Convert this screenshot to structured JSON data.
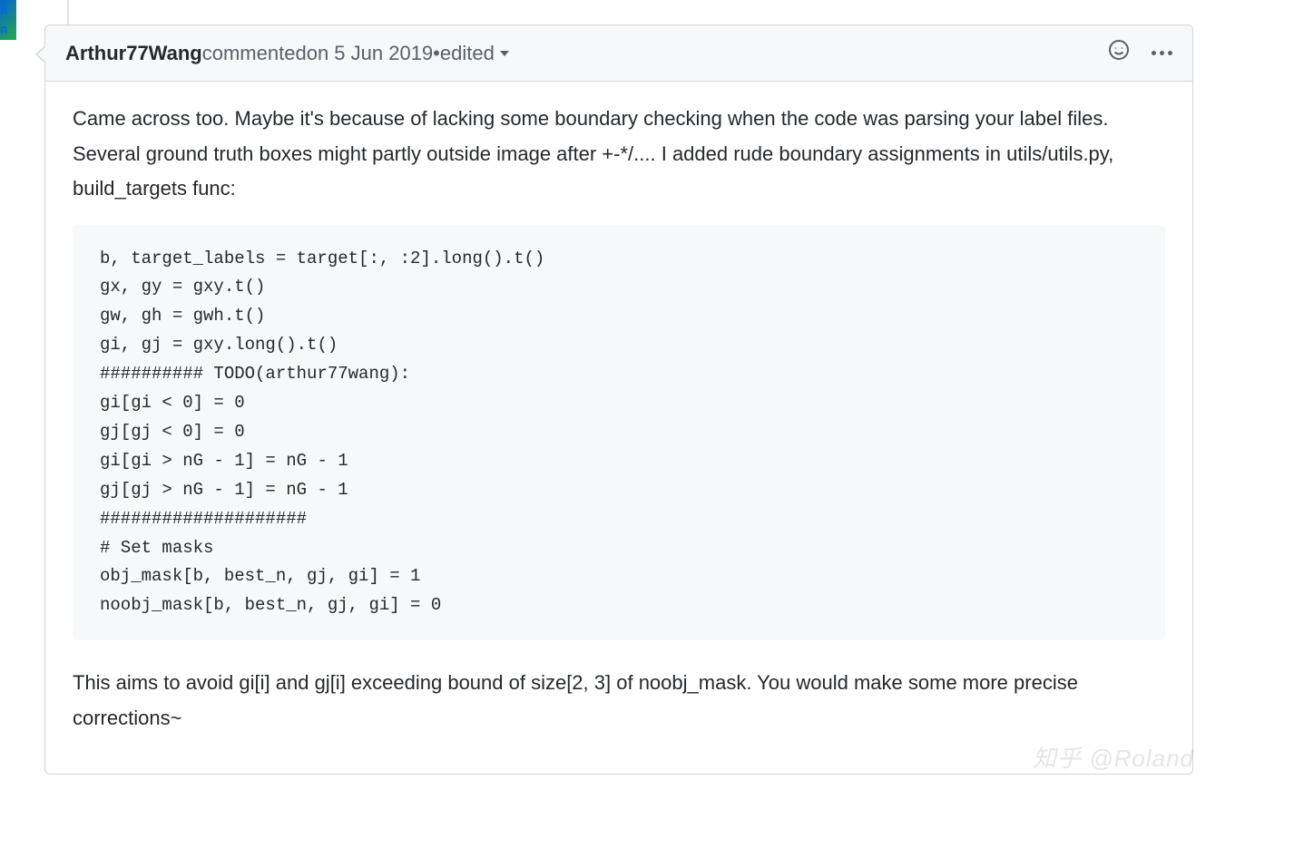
{
  "avatar_text": "A\nn",
  "header": {
    "author": "Arthur77Wang",
    "action": " commented ",
    "timestamp": "on 5 Jun 2019",
    "dot": " • ",
    "edited": "edited"
  },
  "body": {
    "p1": "Came across too. Maybe it's because of lacking some boundary checking when the code was parsing your label files. Several ground truth boxes might partly outside image after +-*/.... I added rude boundary assignments in utils/utils.py, build_targets func:",
    "code": "b, target_labels = target[:, :2].long().t()\ngx, gy = gxy.t()\ngw, gh = gwh.t()\ngi, gj = gxy.long().t()\n########## TODO(arthur77wang):\ngi[gi < 0] = 0\ngj[gj < 0] = 0\ngi[gi > nG - 1] = nG - 1\ngj[gj > nG - 1] = nG - 1\n####################\n# Set masks\nobj_mask[b, best_n, gj, gi] = 1\nnoobj_mask[b, best_n, gj, gi] = 0",
    "p2": "This aims to avoid gi[i] and gj[i] exceeding bound of size[2, 3] of noobj_mask. You would make some more precise corrections~"
  },
  "watermark": "知乎 @Roland"
}
